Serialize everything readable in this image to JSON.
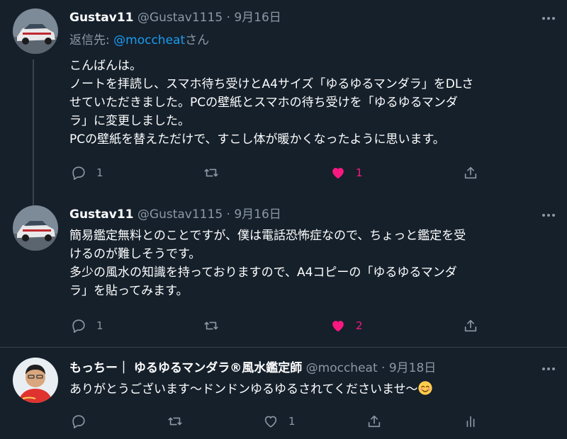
{
  "tweets": [
    {
      "name": "Gustav11",
      "handle": "@Gustav1115",
      "sep": "·",
      "date": "9月16日",
      "reply_prefix": "返信先: ",
      "reply_mention": "@moccheat",
      "reply_suffix": "さん",
      "lines": [
        "こんばんは。",
        "ノートを拝読し、スマホ待ち受けとA4サイズ「ゆるゆるマンダラ」をDLさ",
        "せていただきました。PCの壁紙とスマホの待ち受けを「ゆるゆるマンダ",
        "ラ」に変更しました。",
        "PCの壁紙を替えただけで、すこし体が暖かくなったように思います。"
      ],
      "reply_count": "1",
      "retweet_count": "",
      "like_count": "1"
    },
    {
      "name": "Gustav11",
      "handle": "@Gustav1115",
      "sep": "·",
      "date": "9月16日",
      "lines": [
        "簡易鑑定無料とのことですが、僕は電話恐怖症なので、ちょっと鑑定を受",
        "けるのが難しそうです。",
        "多少の風水の知識を持っておりますので、A4コピーの「ゆるゆるマンダ",
        "ラ」を貼ってみます。"
      ],
      "reply_count": "1",
      "retweet_count": "",
      "like_count": "2"
    },
    {
      "name": "もっちー｜ ゆるゆるマンダラ®風水鑑定師",
      "handle": "@moccheat",
      "sep": "·",
      "date": "9月18日",
      "lines": [
        "ありがとうございます〜ドンドンゆるゆるされてくださいませ〜"
      ],
      "reply_count": "",
      "retweet_count": "",
      "like_count": "1"
    }
  ],
  "icons": {
    "reply": "reply-icon",
    "retweet": "retweet-icon",
    "like": "heart-icon",
    "share": "share-icon",
    "analytics": "analytics-icon",
    "more": "more-icon",
    "emoji": "smiling-face-emoji"
  },
  "colors": {
    "background": "#15202b",
    "muted": "#8b98a5",
    "accent": "#1d9bf0",
    "like": "#f91880",
    "thread_line": "#38444d"
  }
}
